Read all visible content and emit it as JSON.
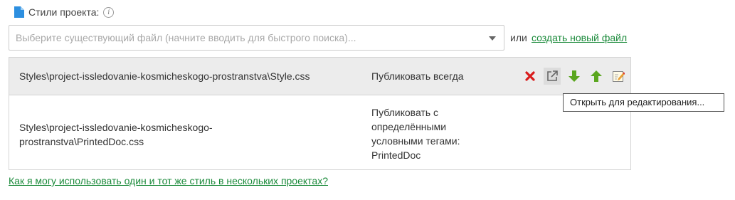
{
  "header": {
    "label": "Стили проекта:",
    "info_icon": "info-icon"
  },
  "file_select": {
    "placeholder": "Выберите существующий файл (начните вводить для быстрого поиска)..."
  },
  "or_label": "или",
  "create_link": "создать новый файл",
  "styles": [
    {
      "path": "Styles\\project-issledovanie-kosmicheskogo-prostranstva\\Style.css",
      "publish": "Публиковать всегда"
    },
    {
      "path": "Styles\\project-issledovanie-kosmicheskogo-prostranstva\\PrintedDoc.css",
      "publish": "Публиковать с определёнными условными тегами: PrintedDoc"
    }
  ],
  "actions": [
    "delete-icon",
    "open-external-icon",
    "move-down-icon",
    "move-up-icon",
    "edit-icon"
  ],
  "tooltip": "Открыть для редактирования...",
  "help_link": "Как я могу использовать один и тот же стиль в нескольких проектах?",
  "colors": {
    "accent": "#1a8a3a",
    "delete": "#d91c1c",
    "arrow": "#5aa61e",
    "row_selected": "#ececec"
  }
}
